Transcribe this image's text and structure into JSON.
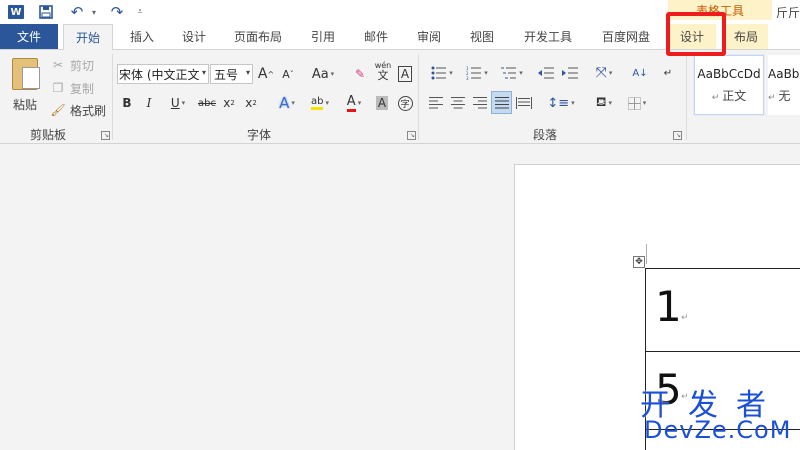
{
  "quick_access": {
    "logo_text": "W",
    "save_icon": "save-icon",
    "undo_icon": "undo-icon",
    "redo_icon": "redo-icon"
  },
  "context_tab_group": "表格工具",
  "title_right": "斤斤",
  "tabs": {
    "file": "文件",
    "home": "开始",
    "insert": "插入",
    "design": "设计",
    "page_layout": "页面布局",
    "references": "引用",
    "mailings": "邮件",
    "review": "审阅",
    "view": "视图",
    "developer": "开发工具",
    "baidu": "百度网盘",
    "table_design": "设计",
    "table_layout": "布局"
  },
  "clipboard": {
    "paste": "粘贴",
    "cut": "剪切",
    "copy": "复制",
    "format_painter": "格式刷",
    "label": "剪贴板"
  },
  "font": {
    "font_name": "宋体 (中文正文",
    "font_size": "五号",
    "grow": "A",
    "shrink": "A",
    "change_case": "Aa",
    "phonetic": "wén",
    "phonetic_sub": "文",
    "border_char": "A",
    "bold": "B",
    "italic": "I",
    "underline": "U",
    "strike": "abc",
    "subscript": "x",
    "subscript_mark": "2",
    "superscript": "x",
    "superscript_mark": "2",
    "text_effect": "A",
    "highlight": "ab",
    "font_color": "A",
    "char_shading": "A",
    "enclose": "字",
    "label": "字体"
  },
  "paragraph": {
    "label": "段落"
  },
  "styles": {
    "normal_sample": "AaBbCcDd",
    "normal_name": "正文",
    "none_sample": "AaBb",
    "none_name": "无"
  },
  "document": {
    "cell_1": "1",
    "cell_2": "5"
  },
  "watermark": {
    "cn": "开发者",
    "en": "DevZe.CoM"
  },
  "colors": {
    "file_tab": "#2b579a",
    "context_tab": "#fdf2c8",
    "highlight_box": "#ee1c1c",
    "watermark": "#1a4fd6"
  }
}
